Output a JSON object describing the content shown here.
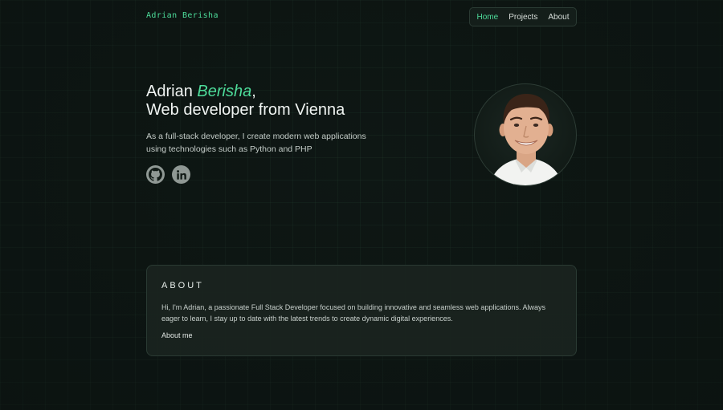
{
  "header": {
    "logo": "Adrian Berisha",
    "nav": [
      {
        "label": "Home",
        "active": true
      },
      {
        "label": "Projects",
        "active": false
      },
      {
        "label": "About",
        "active": false
      }
    ]
  },
  "hero": {
    "title_first": "Adrian ",
    "title_accent": "Berisha",
    "title_comma": ",",
    "title_line2": "Web developer from Vienna",
    "subtitle": "As a full-stack developer, I create modern web applications using technologies such as Python and PHP",
    "socials": [
      {
        "icon": "github-icon"
      },
      {
        "icon": "linkedin-icon"
      }
    ],
    "avatar_alt": "portrait-photo"
  },
  "about": {
    "heading": "ABOUT",
    "text": "Hi, I'm Adrian, a passionate Full Stack Developer focused on building innovative and seamless web applications. Always eager to learn, I stay up to date with the latest trends to create dynamic digital experiences.",
    "link_label": "About me"
  },
  "colors": {
    "accent": "#4ddc9a",
    "background": "#0e1714",
    "card": "#1a2420",
    "border": "#2a3a33"
  }
}
